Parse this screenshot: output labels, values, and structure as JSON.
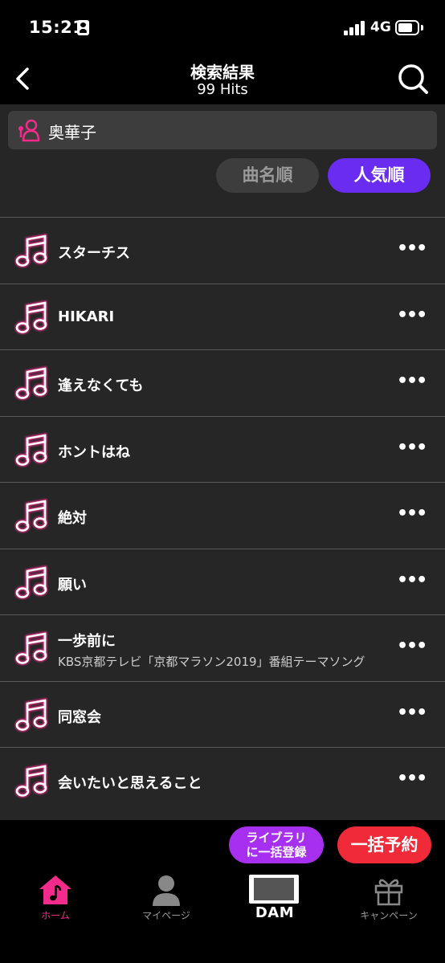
{
  "status": {
    "time": "15:21",
    "network": "4G",
    "battery_level": 0.75
  },
  "header": {
    "title": "検索結果",
    "subtitle": "99 Hits"
  },
  "artist": {
    "name": "奥華子"
  },
  "sort": {
    "by_title": "曲名順",
    "by_popularity": "人気順",
    "active": "by_popularity"
  },
  "songs": [
    {
      "title": "スターチス",
      "subtitle": ""
    },
    {
      "title": "HIKARI",
      "subtitle": ""
    },
    {
      "title": "逢えなくても",
      "subtitle": ""
    },
    {
      "title": "ホントはね",
      "subtitle": ""
    },
    {
      "title": "絶対",
      "subtitle": ""
    },
    {
      "title": "願い",
      "subtitle": ""
    },
    {
      "title": "一歩前に",
      "subtitle": "KBS京都テレビ「京都マラソン2019」番組テーマソング"
    },
    {
      "title": "同窓会",
      "subtitle": ""
    },
    {
      "title": "会いたいと思えること",
      "subtitle": ""
    }
  ],
  "more_icon_text": "•••",
  "actions": {
    "library_line1": "ライブラリ",
    "library_line2": "に一括登録",
    "reserve": "一括予約"
  },
  "tabs": [
    {
      "label": "ホーム",
      "icon": "home-icon"
    },
    {
      "label": "マイページ",
      "icon": "person-icon"
    },
    {
      "label": "DAM",
      "icon": "dam-screen-icon"
    },
    {
      "label": "キャンペーン",
      "icon": "gift-icon"
    }
  ],
  "colors": {
    "accent_pink": "#f52b8c",
    "sort_active": "#6a2cf0",
    "library": "#a72fef",
    "reserve": "#f02a38"
  }
}
